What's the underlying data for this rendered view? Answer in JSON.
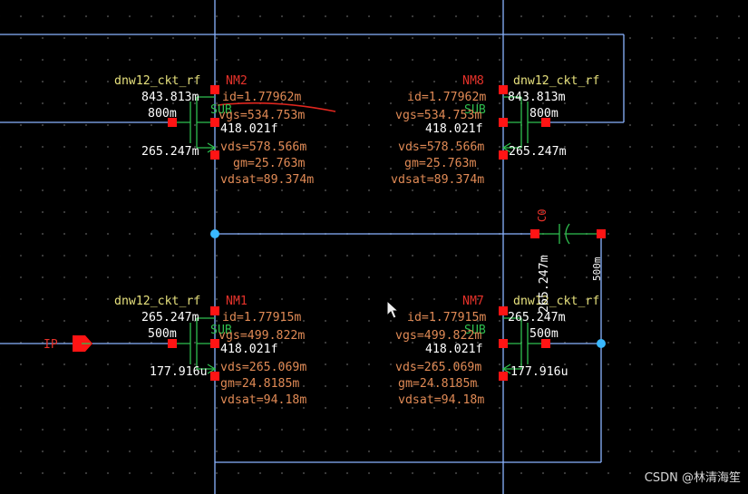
{
  "devices": {
    "nm2": {
      "name": "NM2",
      "model": "dnw12_ckt_rf",
      "sub": "SUB",
      "l": "843.813m",
      "w": "800m",
      "nf": "265.247m",
      "cap": "418.021f",
      "id": "id=1.77962m",
      "vgs": "vgs=534.753m",
      "vds": "vds=578.566m",
      "gm": "gm=25.763m",
      "vdsat": "vdsat=89.374m"
    },
    "nm8": {
      "name": "NM8",
      "model": "dnw12_ckt_rf",
      "sub": "SUB",
      "l": "843.813m",
      "w": "800m",
      "nf": "265.247m",
      "cap": "418.021f",
      "id": "id=1.77962m",
      "vgs": "vgs=534.753m",
      "vds": "vds=578.566m",
      "gm": "gm=25.763m",
      "vdsat": "vdsat=89.374m"
    },
    "nm1": {
      "name": "NM1",
      "model": "dnw12_ckt_rf",
      "sub": "SUB",
      "l": "265.247m",
      "w": "500m",
      "nf": "177.916u",
      "cap": "418.021f",
      "id": "id=1.77915m",
      "vgs": "vgs=499.822m",
      "vds": "vds=265.069m",
      "gm": "gm=24.8185m",
      "vdsat": "vdsat=94.18m"
    },
    "nm7": {
      "name": "NM7",
      "model": "dnw12_ckt_rf",
      "sub": "SUB",
      "l": "265.247m",
      "w": "500m",
      "nf": "177.916u",
      "cap": "418.021f",
      "id": "id=1.77915m",
      "vgs": "vgs=499.822m",
      "vds": "vds=265.069m",
      "gm": "gm=24.8185m",
      "vdsat": "vdsat=94.18m"
    }
  },
  "capacitor": {
    "name": "C0",
    "value": "500m",
    "node_voltage": "265.247m"
  },
  "pin": {
    "label": "IP"
  },
  "watermark": "CSDN @林清海笙",
  "colors": {
    "background": "#000000",
    "wire": "#8ab4ff",
    "device": "#2fbf4f",
    "pin": "#ff1414",
    "model_label": "#e6e07c",
    "instance_label": "#e6322a",
    "oppoint_label": "#e08a55",
    "junction": "#39b8ff"
  }
}
